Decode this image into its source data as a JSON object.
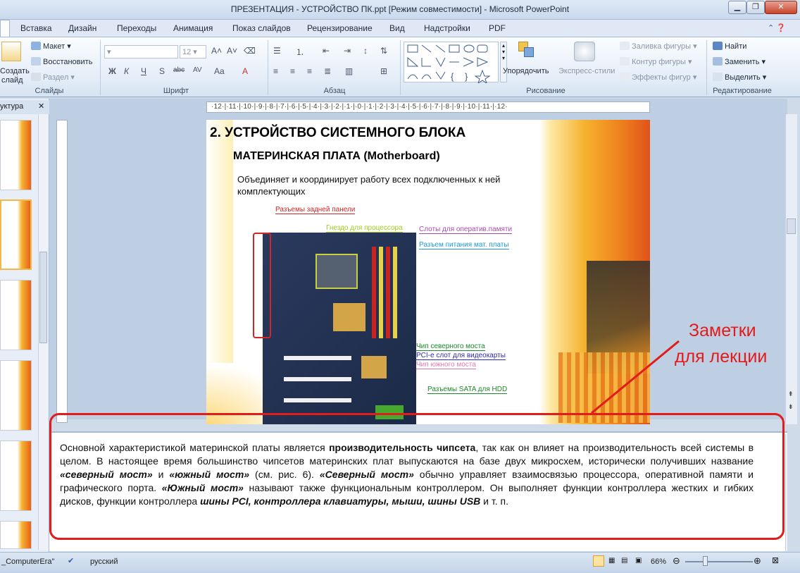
{
  "window": {
    "title": "ПРЕЗЕНТАЦИЯ - УСТРОЙСТВО ПК.ppt [Режим совместимости]  -  Microsoft PowerPoint",
    "minimize": "▁",
    "restore": "❐",
    "close": "✕"
  },
  "ribbon_tabs": [
    "Вставка",
    "Дизайн",
    "Переходы",
    "Анимация",
    "Показ слайдов",
    "Рецензирование",
    "Вид",
    "Надстройки",
    "PDF"
  ],
  "slides_group": {
    "create": "Создать",
    "create2": "слайд",
    "layout": "Макет",
    "reset": "Восстановить",
    "section": "Раздел",
    "label": "Слайды"
  },
  "font_group": {
    "font_size": "12",
    "label": "Шрифт",
    "buttons": [
      "Ж",
      "К",
      "Ч",
      "S",
      "abc",
      "AV",
      "Aa",
      "A"
    ]
  },
  "paragraph_group": {
    "label": "Абзац"
  },
  "drawing_group": {
    "arrange": "Упорядочить",
    "quick_styles": "Экспресс-стили",
    "fill": "Заливка фигуры",
    "outline": "Контур фигуры",
    "effects": "Эффекты фигур",
    "label": "Рисование"
  },
  "editing_group": {
    "find": "Найти",
    "replace": "Заменить",
    "select": "Выделить",
    "label": "Редактирование"
  },
  "outline_panel": {
    "tab": "уктура"
  },
  "ruler": {
    "h": "·12·|·11·|·10·|·9·|·8·|·7·|·6·|·5·|·4·|·3·|·2·|·1·|·0·|·1·|·2·|·3·|·4·|·5·|·6·|·7·|·8·|·9·|·10·|·11·|·12·"
  },
  "slide": {
    "heading_num": "2.",
    "heading": "УСТРОЙСТВО СИСТЕМНОГО  БЛОКА",
    "subheading": "МАТЕРИНСКАЯ ПЛАТА (Motherboard)",
    "body": "Объединяет и координирует работу всех подключенных к ней комплектующих",
    "callouts": [
      {
        "text": "Разъемы задней панели",
        "color": "#d22626"
      },
      {
        "text": "Гнездо для процессора",
        "color": "#9ccc1e"
      },
      {
        "text": "Слоты для оператив.памяти",
        "color": "#a64ca6"
      },
      {
        "text": "Разъем питания мат. платы",
        "color": "#1f9ad6"
      },
      {
        "text": "Чип северного моста",
        "color": "#1a8a2a"
      },
      {
        "text": "PCI-e слот для видеокарты",
        "color": "#2b2bb8"
      },
      {
        "text": "Чип южного моста",
        "color": "#e07ab0"
      },
      {
        "text": "Разъемы SATA для HDD",
        "color": "#1a8a2a"
      }
    ]
  },
  "annotation": {
    "line1": "Заметки",
    "line2": "для лекции",
    "color": "#e21b1b"
  },
  "notes": {
    "t1": "Основной характеристикой материнской платы является ",
    "b1": "производительность чипсета",
    "t2": ", так как он влияет на производительность всей системы в целом. В настоящее время большинство чипсетов материнских плат выпускаются на базе двух микросхем, исторически получивших название  ",
    "bi1": "«северный мост»",
    "t3": " и ",
    "bi2": "«южный мост»",
    "t4": " (см. рис. 6). ",
    "bi3": "«Северный мост»",
    "t5": " обычно управляет взаимосвязью процессора, оперативной памяти и графического порта. ",
    "bi4": "«Южный мост»",
    "t6": " называют также функциональным контроллером.  Он выполняет функции контроллера жестких и гибких дисков, функции контроллера ",
    "bi5": "шины PCI, контроллера клавиатуры, мыши, шины USB",
    "t7": " и т. п."
  },
  "statusbar": {
    "theme": "_ComputerEra\"",
    "language": "русский",
    "zoom": "66%"
  },
  "colors": {
    "accent_orange": "#f29a1f",
    "ribbon_blue": "#dfe8f4",
    "red_annotation": "#e21b1b"
  }
}
